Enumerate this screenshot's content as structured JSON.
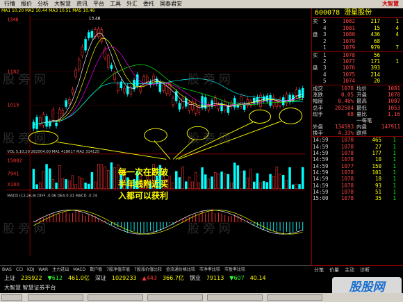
{
  "menu": [
    "行情",
    "报价",
    "分析",
    "大智慧",
    "资讯",
    "平台",
    "工具",
    "外汇",
    "委托",
    "国泰君安"
  ],
  "menu_logo": "大智慧",
  "info_line": "MA1 10.20 MA2 10.44 MA3 10.51 MA5 10.46",
  "price_labels": {
    "top": "1348",
    "mid1": "1182",
    "mid2": "1015",
    "high_mark": "13.48"
  },
  "vol_info": "VOL 5,10,20  282504.00  MA1 418617  MA2 314125",
  "vol_labels": {
    "v1": "15882",
    "v2": "7941",
    "v3": "X100"
  },
  "macd_info": "MACD (12,26,9)  DIFF -0.06  DEA 0.31  MACD -0.74",
  "annotation": [
    "每一次在跌破",
    "半年线附近买",
    "入都可以获利"
  ],
  "stock": {
    "code": "600078",
    "name": "澄星股份"
  },
  "order_book": [
    {
      "side": "卖",
      "lvl": "5",
      "price": "1082",
      "vol": "217",
      "chg": "1"
    },
    {
      "side": "",
      "lvl": "4",
      "price": "1081",
      "vol": "15",
      "chg": "4"
    },
    {
      "side": "盘",
      "lvl": "3",
      "price": "1080",
      "vol": "436",
      "chg": "4"
    },
    {
      "side": "",
      "lvl": "2",
      "price": "1079",
      "vol": "68",
      "chg": ""
    },
    {
      "side": "",
      "lvl": "1",
      "price": "1079",
      "vol": "979",
      "chg": "7"
    },
    {
      "side": "买",
      "lvl": "1",
      "price": "1078",
      "vol": "56",
      "chg": ""
    },
    {
      "side": "",
      "lvl": "2",
      "price": "1077",
      "vol": "171",
      "chg": "1"
    },
    {
      "side": "盘",
      "lvl": "3",
      "price": "1076",
      "vol": "393",
      "chg": ""
    },
    {
      "side": "",
      "lvl": "4",
      "price": "1075",
      "vol": "214",
      "chg": ""
    },
    {
      "side": "",
      "lvl": "5",
      "price": "1074",
      "vol": "20",
      "chg": ""
    }
  ],
  "quotes": [
    {
      "l1": "成交",
      "v1": "1078",
      "l2": "均价",
      "v2": "1081"
    },
    {
      "l1": "涨跌",
      "v1": "0.05",
      "l2": "开盘",
      "v2": "1070"
    },
    {
      "l1": "幅度",
      "v1": "0.46%",
      "l2": "最高",
      "v2": "1087"
    },
    {
      "l1": "总手",
      "v1": "282504",
      "l2": "最低",
      "v2": "1053"
    },
    {
      "l1": "现手",
      "v1": "68",
      "l2": "量比",
      "v2": "1.16"
    },
    {
      "l1": "",
      "v1": "",
      "l2": "一每笔",
      "v2": ""
    },
    {
      "l1": "外盘",
      "v1": "134593",
      "l2": "内盘",
      "v2": "147911"
    },
    {
      "l1": "换手",
      "v1": "4.33%",
      "l2": "跌停",
      "v2": ""
    }
  ],
  "ticks": [
    {
      "t": "14:59",
      "p": "1078",
      "v": "465",
      "b": "1"
    },
    {
      "t": "14:59",
      "p": "1078",
      "v": "27",
      "b": "1"
    },
    {
      "t": "14:59",
      "p": "1078",
      "v": "177",
      "b": "1"
    },
    {
      "t": "14:59",
      "p": "1078",
      "v": "10",
      "b": "1"
    },
    {
      "t": "14:59",
      "p": "1077",
      "v": "150",
      "b": "1"
    },
    {
      "t": "14:59",
      "p": "1078",
      "v": "101",
      "b": "1"
    },
    {
      "t": "14:59",
      "p": "1078",
      "v": "18",
      "b": "1"
    },
    {
      "t": "14:59",
      "p": "1078",
      "v": "93",
      "b": "1"
    },
    {
      "t": "14:59",
      "p": "1078",
      "v": "51",
      "b": "1"
    },
    {
      "t": "15:00",
      "p": "1078",
      "v": "35",
      "b": "1"
    }
  ],
  "indicator_tabs": [
    "BIAS",
    "CCI",
    "KDJ",
    "WAR",
    "主力进出",
    "MACD",
    "数户板",
    "7股净值市值",
    "7股涨价值比较",
    "金流通价格比较",
    "市净率比较",
    "市盈率比较"
  ],
  "right_tabs": [
    "分笔",
    "价量",
    "主动",
    "诊断"
  ],
  "status_line1": [
    {
      "text": "上证",
      "cls": ""
    },
    {
      "text": "235922",
      "cls": "yel"
    },
    {
      "text": "▼612",
      "cls": "green"
    },
    {
      "text": "461.0亿",
      "cls": "yel"
    },
    {
      "text": "深证",
      "cls": ""
    },
    {
      "text": "1029233",
      "cls": "yel"
    },
    {
      "text": "▲443",
      "cls": "red"
    },
    {
      "text": "366.7亿",
      "cls": "yel"
    },
    {
      "text": "钢业",
      "cls": ""
    },
    {
      "text": "79113",
      "cls": "yel"
    },
    {
      "text": "▼607",
      "cls": "green"
    },
    {
      "text": "40.14",
      "cls": "yel"
    }
  ],
  "status_line2": "大智慧  智慧证券平台",
  "watermark_text": "股股网",
  "bg_watermark": "股 旁 网"
}
